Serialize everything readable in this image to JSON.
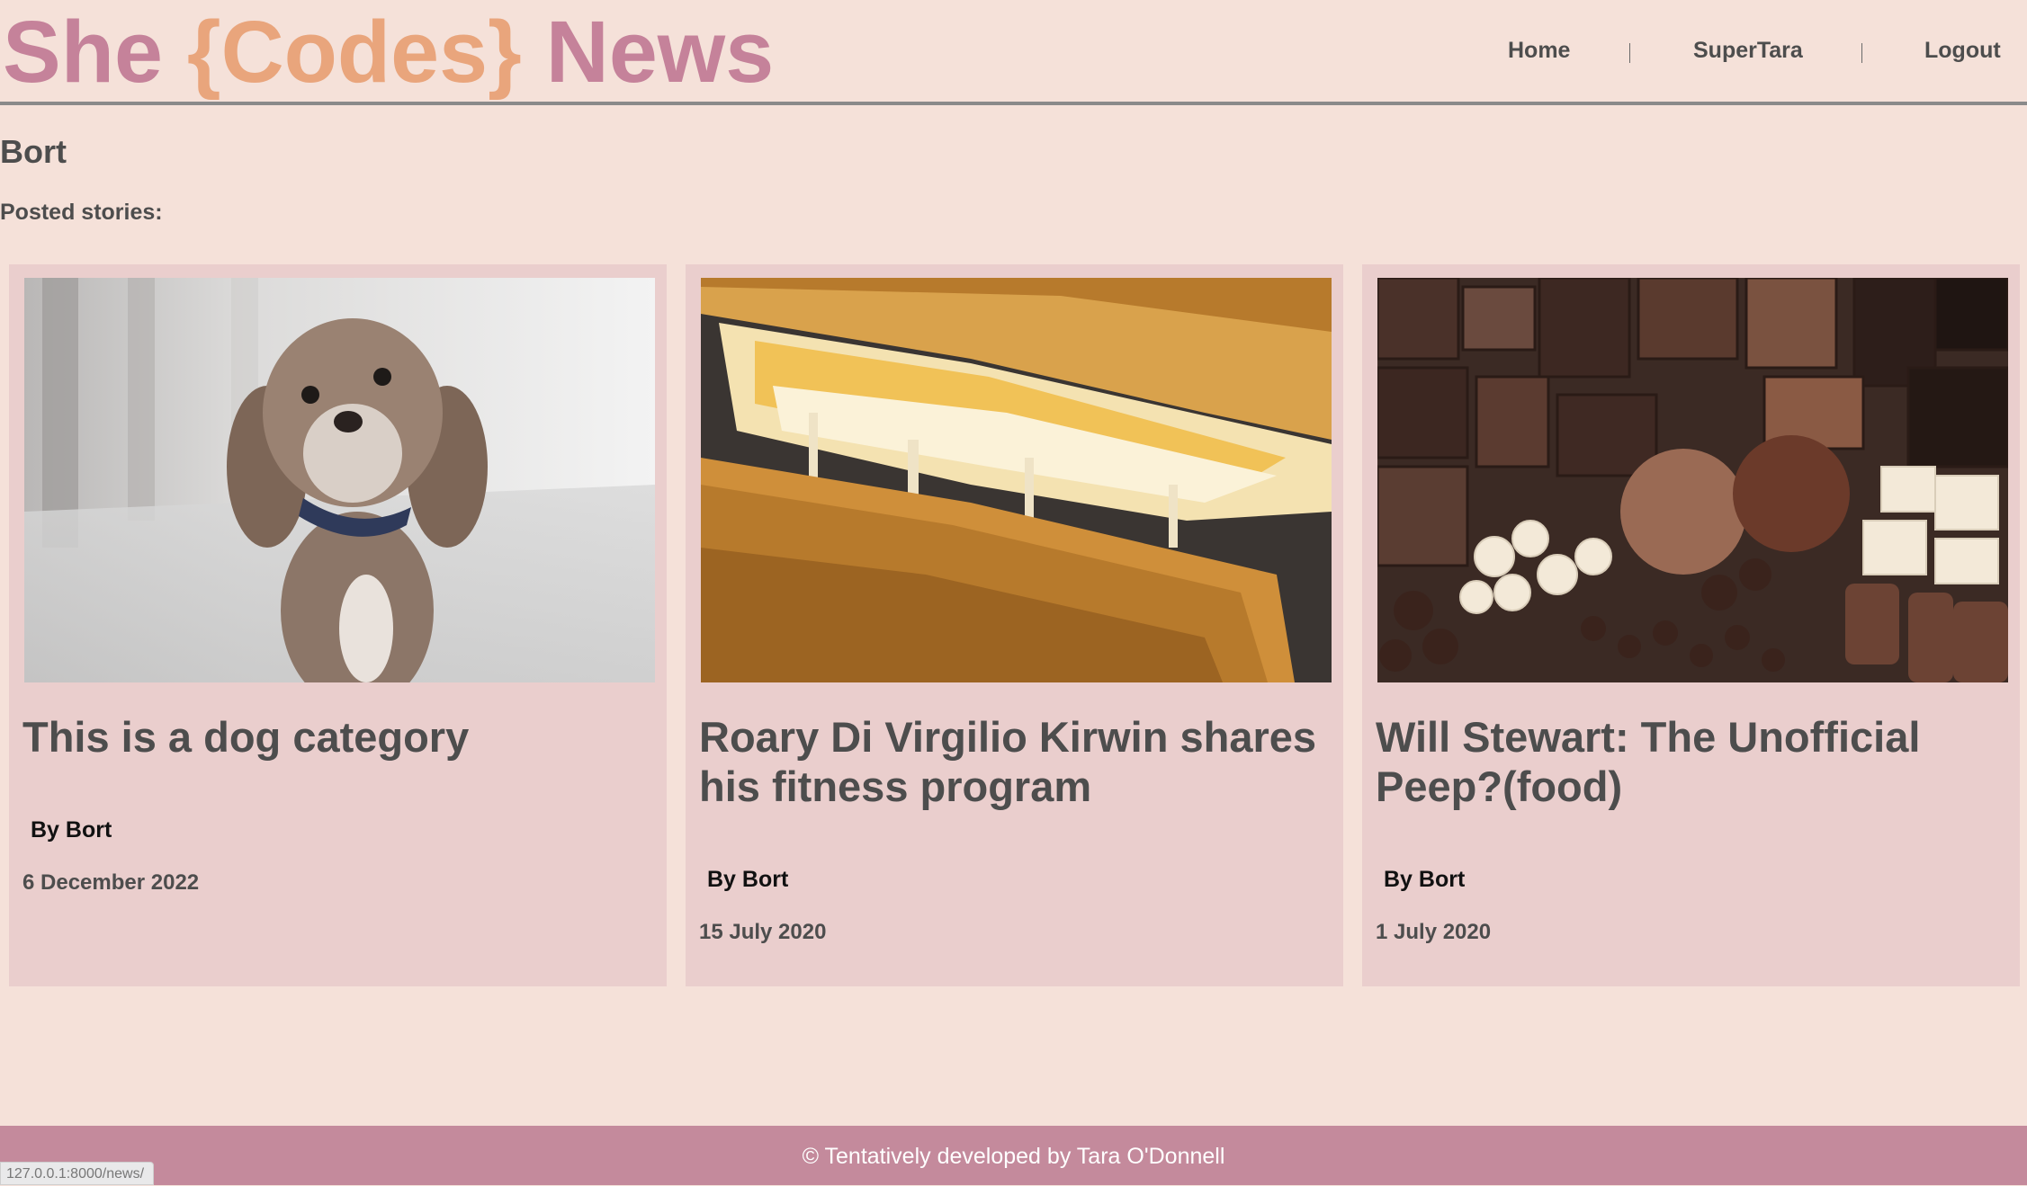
{
  "header": {
    "logo": {
      "part1": "She ",
      "part2": "{Codes}",
      "part3": " News"
    },
    "nav": {
      "home": "Home",
      "user": "SuperTara",
      "logout": "Logout"
    }
  },
  "page": {
    "title": "Bort",
    "subtitle": "Posted stories:"
  },
  "stories": [
    {
      "title": "This is a dog category",
      "author": "By Bort",
      "date": "6 December 2022",
      "image": "dog-photo"
    },
    {
      "title": "Roary Di Virgilio Kirwin shares his fitness program",
      "author": "By Bort",
      "date": "15 July 2020",
      "image": "grilled-cheese-photo"
    },
    {
      "title": "Will Stewart: The Unofficial Peep?(food)",
      "author": "By Bort",
      "date": "1 July 2020",
      "image": "chocolate-photo"
    }
  ],
  "footer": {
    "text": "© Tentatively developed by Tara O'Donnell"
  },
  "status_bar": {
    "url": "127.0.0.1:8000/news/"
  },
  "colors": {
    "background": "#f5e1d9",
    "card": "#eacecd",
    "logo_pink": "#c5829a",
    "logo_orange": "#e9a57c",
    "footer": "#c48a9c",
    "text": "#4d4d4d"
  }
}
